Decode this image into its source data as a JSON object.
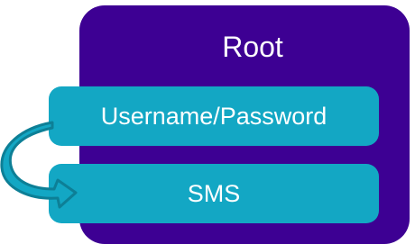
{
  "diagram": {
    "container": {
      "label": "Root"
    },
    "steps": [
      {
        "label": "Username/Password"
      },
      {
        "label": "SMS"
      }
    ],
    "arrow": {
      "from": "Username/Password",
      "to": "SMS",
      "icon": "curved-arrow-icon"
    }
  },
  "colors": {
    "root": "#3d0093",
    "step": "#13a7c4",
    "arrow_fill": "#13a7c4",
    "arrow_stroke": "#0d7f96",
    "text": "#ffffff"
  }
}
